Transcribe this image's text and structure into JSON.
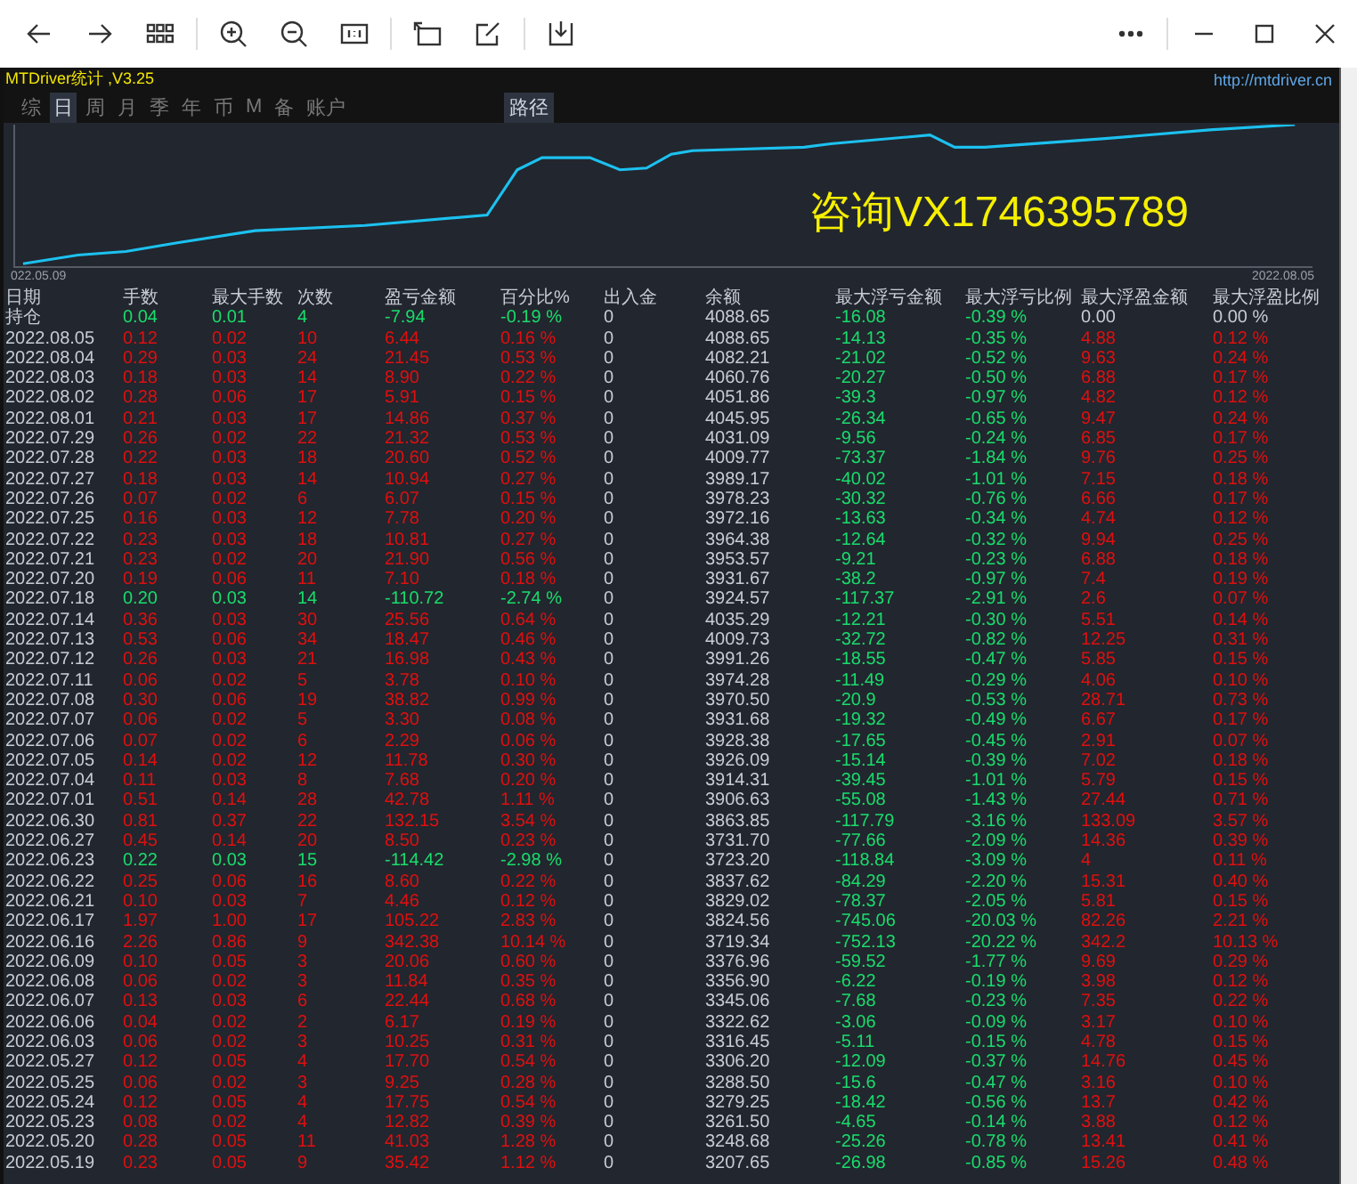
{
  "app": {
    "title": "MTDriver统计 ,V3.25",
    "url": "http://mtdriver.cn"
  },
  "tabs": [
    {
      "label": "综",
      "selected": false
    },
    {
      "label": "日",
      "selected": true
    },
    {
      "label": "周",
      "selected": false
    },
    {
      "label": "月",
      "selected": false
    },
    {
      "label": "季",
      "selected": false
    },
    {
      "label": "年",
      "selected": false
    },
    {
      "label": "币",
      "selected": false
    },
    {
      "label": "M",
      "selected": false
    },
    {
      "label": "备",
      "selected": false
    },
    {
      "label": "账户",
      "selected": false
    }
  ],
  "path_button": "路径",
  "chart": {
    "start_date": "022.05.09",
    "end_date": "2022.08.05",
    "overlay_text": "咨询VX1746395789"
  },
  "table": {
    "columns": [
      "日期",
      "手数",
      "最大手数",
      "次数",
      "盈亏金额",
      "百分比%",
      "出入金",
      "余额",
      "最大浮亏金额",
      "最大浮亏比例",
      "最大浮盈金额",
      "最大浮盈比例"
    ],
    "rows": [
      {
        "kind": "open",
        "cells": [
          "持仓",
          "0.04",
          "0.01",
          "4",
          "-7.94",
          "-0.19 %",
          "0",
          "4088.65",
          "-16.08",
          "-0.39 %",
          "0.00",
          "0.00 %"
        ]
      },
      {
        "kind": "profit",
        "cells": [
          "2022.08.05",
          "0.12",
          "0.02",
          "10",
          "6.44",
          "0.16 %",
          "0",
          "4088.65",
          "-14.13",
          "-0.35 %",
          "4.88",
          "0.12 %"
        ]
      },
      {
        "kind": "profit",
        "cells": [
          "2022.08.04",
          "0.29",
          "0.03",
          "24",
          "21.45",
          "0.53 %",
          "0",
          "4082.21",
          "-21.02",
          "-0.52 %",
          "9.63",
          "0.24 %"
        ]
      },
      {
        "kind": "profit",
        "cells": [
          "2022.08.03",
          "0.18",
          "0.03",
          "14",
          "8.90",
          "0.22 %",
          "0",
          "4060.76",
          "-20.27",
          "-0.50 %",
          "6.88",
          "0.17 %"
        ]
      },
      {
        "kind": "profit",
        "cells": [
          "2022.08.02",
          "0.28",
          "0.06",
          "17",
          "5.91",
          "0.15 %",
          "0",
          "4051.86",
          "-39.3",
          "-0.97 %",
          "4.82",
          "0.12 %"
        ]
      },
      {
        "kind": "profit",
        "cells": [
          "2022.08.01",
          "0.21",
          "0.03",
          "17",
          "14.86",
          "0.37 %",
          "0",
          "4045.95",
          "-26.34",
          "-0.65 %",
          "9.47",
          "0.24 %"
        ]
      },
      {
        "kind": "profit",
        "cells": [
          "2022.07.29",
          "0.26",
          "0.02",
          "22",
          "21.32",
          "0.53 %",
          "0",
          "4031.09",
          "-9.56",
          "-0.24 %",
          "6.85",
          "0.17 %"
        ]
      },
      {
        "kind": "profit",
        "cells": [
          "2022.07.28",
          "0.22",
          "0.03",
          "18",
          "20.60",
          "0.52 %",
          "0",
          "4009.77",
          "-73.37",
          "-1.84 %",
          "9.76",
          "0.25 %"
        ]
      },
      {
        "kind": "profit",
        "cells": [
          "2022.07.27",
          "0.18",
          "0.03",
          "14",
          "10.94",
          "0.27 %",
          "0",
          "3989.17",
          "-40.02",
          "-1.01 %",
          "7.15",
          "0.18 %"
        ]
      },
      {
        "kind": "profit",
        "cells": [
          "2022.07.26",
          "0.07",
          "0.02",
          "6",
          "6.07",
          "0.15 %",
          "0",
          "3978.23",
          "-30.32",
          "-0.76 %",
          "6.66",
          "0.17 %"
        ]
      },
      {
        "kind": "profit",
        "cells": [
          "2022.07.25",
          "0.16",
          "0.03",
          "12",
          "7.78",
          "0.20 %",
          "0",
          "3972.16",
          "-13.63",
          "-0.34 %",
          "4.74",
          "0.12 %"
        ]
      },
      {
        "kind": "profit",
        "cells": [
          "2022.07.22",
          "0.23",
          "0.03",
          "18",
          "10.81",
          "0.27 %",
          "0",
          "3964.38",
          "-12.64",
          "-0.32 %",
          "9.94",
          "0.25 %"
        ]
      },
      {
        "kind": "profit",
        "cells": [
          "2022.07.21",
          "0.23",
          "0.02",
          "20",
          "21.90",
          "0.56 %",
          "0",
          "3953.57",
          "-9.21",
          "-0.23 %",
          "6.88",
          "0.18 %"
        ]
      },
      {
        "kind": "profit",
        "cells": [
          "2022.07.20",
          "0.19",
          "0.06",
          "11",
          "7.10",
          "0.18 %",
          "0",
          "3931.67",
          "-38.2",
          "-0.97 %",
          "7.4",
          "0.19 %"
        ]
      },
      {
        "kind": "loss",
        "cells": [
          "2022.07.18",
          "0.20",
          "0.03",
          "14",
          "-110.72",
          "-2.74 %",
          "0",
          "3924.57",
          "-117.37",
          "-2.91 %",
          "2.6",
          "0.07 %"
        ]
      },
      {
        "kind": "profit",
        "cells": [
          "2022.07.14",
          "0.36",
          "0.03",
          "30",
          "25.56",
          "0.64 %",
          "0",
          "4035.29",
          "-12.21",
          "-0.30 %",
          "5.51",
          "0.14 %"
        ]
      },
      {
        "kind": "profit",
        "cells": [
          "2022.07.13",
          "0.53",
          "0.06",
          "34",
          "18.47",
          "0.46 %",
          "0",
          "4009.73",
          "-32.72",
          "-0.82 %",
          "12.25",
          "0.31 %"
        ]
      },
      {
        "kind": "profit",
        "cells": [
          "2022.07.12",
          "0.26",
          "0.03",
          "21",
          "16.98",
          "0.43 %",
          "0",
          "3991.26",
          "-18.55",
          "-0.47 %",
          "5.85",
          "0.15 %"
        ]
      },
      {
        "kind": "profit",
        "cells": [
          "2022.07.11",
          "0.06",
          "0.02",
          "5",
          "3.78",
          "0.10 %",
          "0",
          "3974.28",
          "-11.49",
          "-0.29 %",
          "4.06",
          "0.10 %"
        ]
      },
      {
        "kind": "profit",
        "cells": [
          "2022.07.08",
          "0.30",
          "0.06",
          "19",
          "38.82",
          "0.99 %",
          "0",
          "3970.50",
          "-20.9",
          "-0.53 %",
          "28.71",
          "0.73 %"
        ]
      },
      {
        "kind": "profit",
        "cells": [
          "2022.07.07",
          "0.06",
          "0.02",
          "5",
          "3.30",
          "0.08 %",
          "0",
          "3931.68",
          "-19.32",
          "-0.49 %",
          "6.67",
          "0.17 %"
        ]
      },
      {
        "kind": "profit",
        "cells": [
          "2022.07.06",
          "0.07",
          "0.02",
          "6",
          "2.29",
          "0.06 %",
          "0",
          "3928.38",
          "-17.65",
          "-0.45 %",
          "2.91",
          "0.07 %"
        ]
      },
      {
        "kind": "profit",
        "cells": [
          "2022.07.05",
          "0.14",
          "0.02",
          "12",
          "11.78",
          "0.30 %",
          "0",
          "3926.09",
          "-15.14",
          "-0.39 %",
          "7.02",
          "0.18 %"
        ]
      },
      {
        "kind": "profit",
        "cells": [
          "2022.07.04",
          "0.11",
          "0.03",
          "8",
          "7.68",
          "0.20 %",
          "0",
          "3914.31",
          "-39.45",
          "-1.01 %",
          "5.79",
          "0.15 %"
        ]
      },
      {
        "kind": "profit",
        "cells": [
          "2022.07.01",
          "0.51",
          "0.14",
          "28",
          "42.78",
          "1.11 %",
          "0",
          "3906.63",
          "-55.08",
          "-1.43 %",
          "27.44",
          "0.71 %"
        ]
      },
      {
        "kind": "profit",
        "cells": [
          "2022.06.30",
          "0.81",
          "0.37",
          "22",
          "132.15",
          "3.54 %",
          "0",
          "3863.85",
          "-117.79",
          "-3.16 %",
          "133.09",
          "3.57 %"
        ]
      },
      {
        "kind": "profit",
        "cells": [
          "2022.06.27",
          "0.45",
          "0.14",
          "20",
          "8.50",
          "0.23 %",
          "0",
          "3731.70",
          "-77.66",
          "-2.09 %",
          "14.36",
          "0.39 %"
        ]
      },
      {
        "kind": "loss",
        "cells": [
          "2022.06.23",
          "0.22",
          "0.03",
          "15",
          "-114.42",
          "-2.98 %",
          "0",
          "3723.20",
          "-118.84",
          "-3.09 %",
          "4",
          "0.11 %"
        ]
      },
      {
        "kind": "profit",
        "cells": [
          "2022.06.22",
          "0.25",
          "0.06",
          "16",
          "8.60",
          "0.22 %",
          "0",
          "3837.62",
          "-84.29",
          "-2.20 %",
          "15.31",
          "0.40 %"
        ]
      },
      {
        "kind": "profit",
        "cells": [
          "2022.06.21",
          "0.10",
          "0.03",
          "7",
          "4.46",
          "0.12 %",
          "0",
          "3829.02",
          "-78.37",
          "-2.05 %",
          "5.81",
          "0.15 %"
        ]
      },
      {
        "kind": "profit",
        "cells": [
          "2022.06.17",
          "1.97",
          "1.00",
          "17",
          "105.22",
          "2.83 %",
          "0",
          "3824.56",
          "-745.06",
          "-20.03 %",
          "82.26",
          "2.21 %"
        ]
      },
      {
        "kind": "profit",
        "cells": [
          "2022.06.16",
          "2.26",
          "0.86",
          "9",
          "342.38",
          "10.14 %",
          "0",
          "3719.34",
          "-752.13",
          "-20.22 %",
          "342.2",
          "10.13 %"
        ]
      },
      {
        "kind": "profit",
        "cells": [
          "2022.06.09",
          "0.10",
          "0.05",
          "3",
          "20.06",
          "0.60 %",
          "0",
          "3376.96",
          "-59.52",
          "-1.77 %",
          "9.69",
          "0.29 %"
        ]
      },
      {
        "kind": "profit",
        "cells": [
          "2022.06.08",
          "0.06",
          "0.02",
          "3",
          "11.84",
          "0.35 %",
          "0",
          "3356.90",
          "-6.22",
          "-0.19 %",
          "3.98",
          "0.12 %"
        ]
      },
      {
        "kind": "profit",
        "cells": [
          "2022.06.07",
          "0.13",
          "0.03",
          "6",
          "22.44",
          "0.68 %",
          "0",
          "3345.06",
          "-7.68",
          "-0.23 %",
          "7.35",
          "0.22 %"
        ]
      },
      {
        "kind": "profit",
        "cells": [
          "2022.06.06",
          "0.04",
          "0.02",
          "2",
          "6.17",
          "0.19 %",
          "0",
          "3322.62",
          "-3.06",
          "-0.09 %",
          "3.17",
          "0.10 %"
        ]
      },
      {
        "kind": "profit",
        "cells": [
          "2022.06.03",
          "0.06",
          "0.02",
          "3",
          "10.25",
          "0.31 %",
          "0",
          "3316.45",
          "-5.11",
          "-0.15 %",
          "4.78",
          "0.15 %"
        ]
      },
      {
        "kind": "profit",
        "cells": [
          "2022.05.27",
          "0.12",
          "0.05",
          "4",
          "17.70",
          "0.54 %",
          "0",
          "3306.20",
          "-12.09",
          "-0.37 %",
          "14.76",
          "0.45 %"
        ]
      },
      {
        "kind": "profit",
        "cells": [
          "2022.05.25",
          "0.06",
          "0.02",
          "3",
          "9.25",
          "0.28 %",
          "0",
          "3288.50",
          "-15.6",
          "-0.47 %",
          "3.16",
          "0.10 %"
        ]
      },
      {
        "kind": "profit",
        "cells": [
          "2022.05.24",
          "0.12",
          "0.05",
          "4",
          "17.75",
          "0.54 %",
          "0",
          "3279.25",
          "-18.42",
          "-0.56 %",
          "13.7",
          "0.42 %"
        ]
      },
      {
        "kind": "profit",
        "cells": [
          "2022.05.23",
          "0.08",
          "0.02",
          "4",
          "12.82",
          "0.39 %",
          "0",
          "3261.50",
          "-4.65",
          "-0.14 %",
          "3.88",
          "0.12 %"
        ]
      },
      {
        "kind": "profit",
        "cells": [
          "2022.05.20",
          "0.28",
          "0.05",
          "11",
          "41.03",
          "1.28 %",
          "0",
          "3248.68",
          "-25.26",
          "-0.78 %",
          "13.41",
          "0.41 %"
        ]
      },
      {
        "kind": "profit",
        "cells": [
          "2022.05.19",
          "0.23",
          "0.05",
          "9",
          "35.42",
          "1.12 %",
          "0",
          "3207.65",
          "-26.98",
          "-0.85 %",
          "15.26",
          "0.48 %"
        ]
      }
    ]
  }
}
